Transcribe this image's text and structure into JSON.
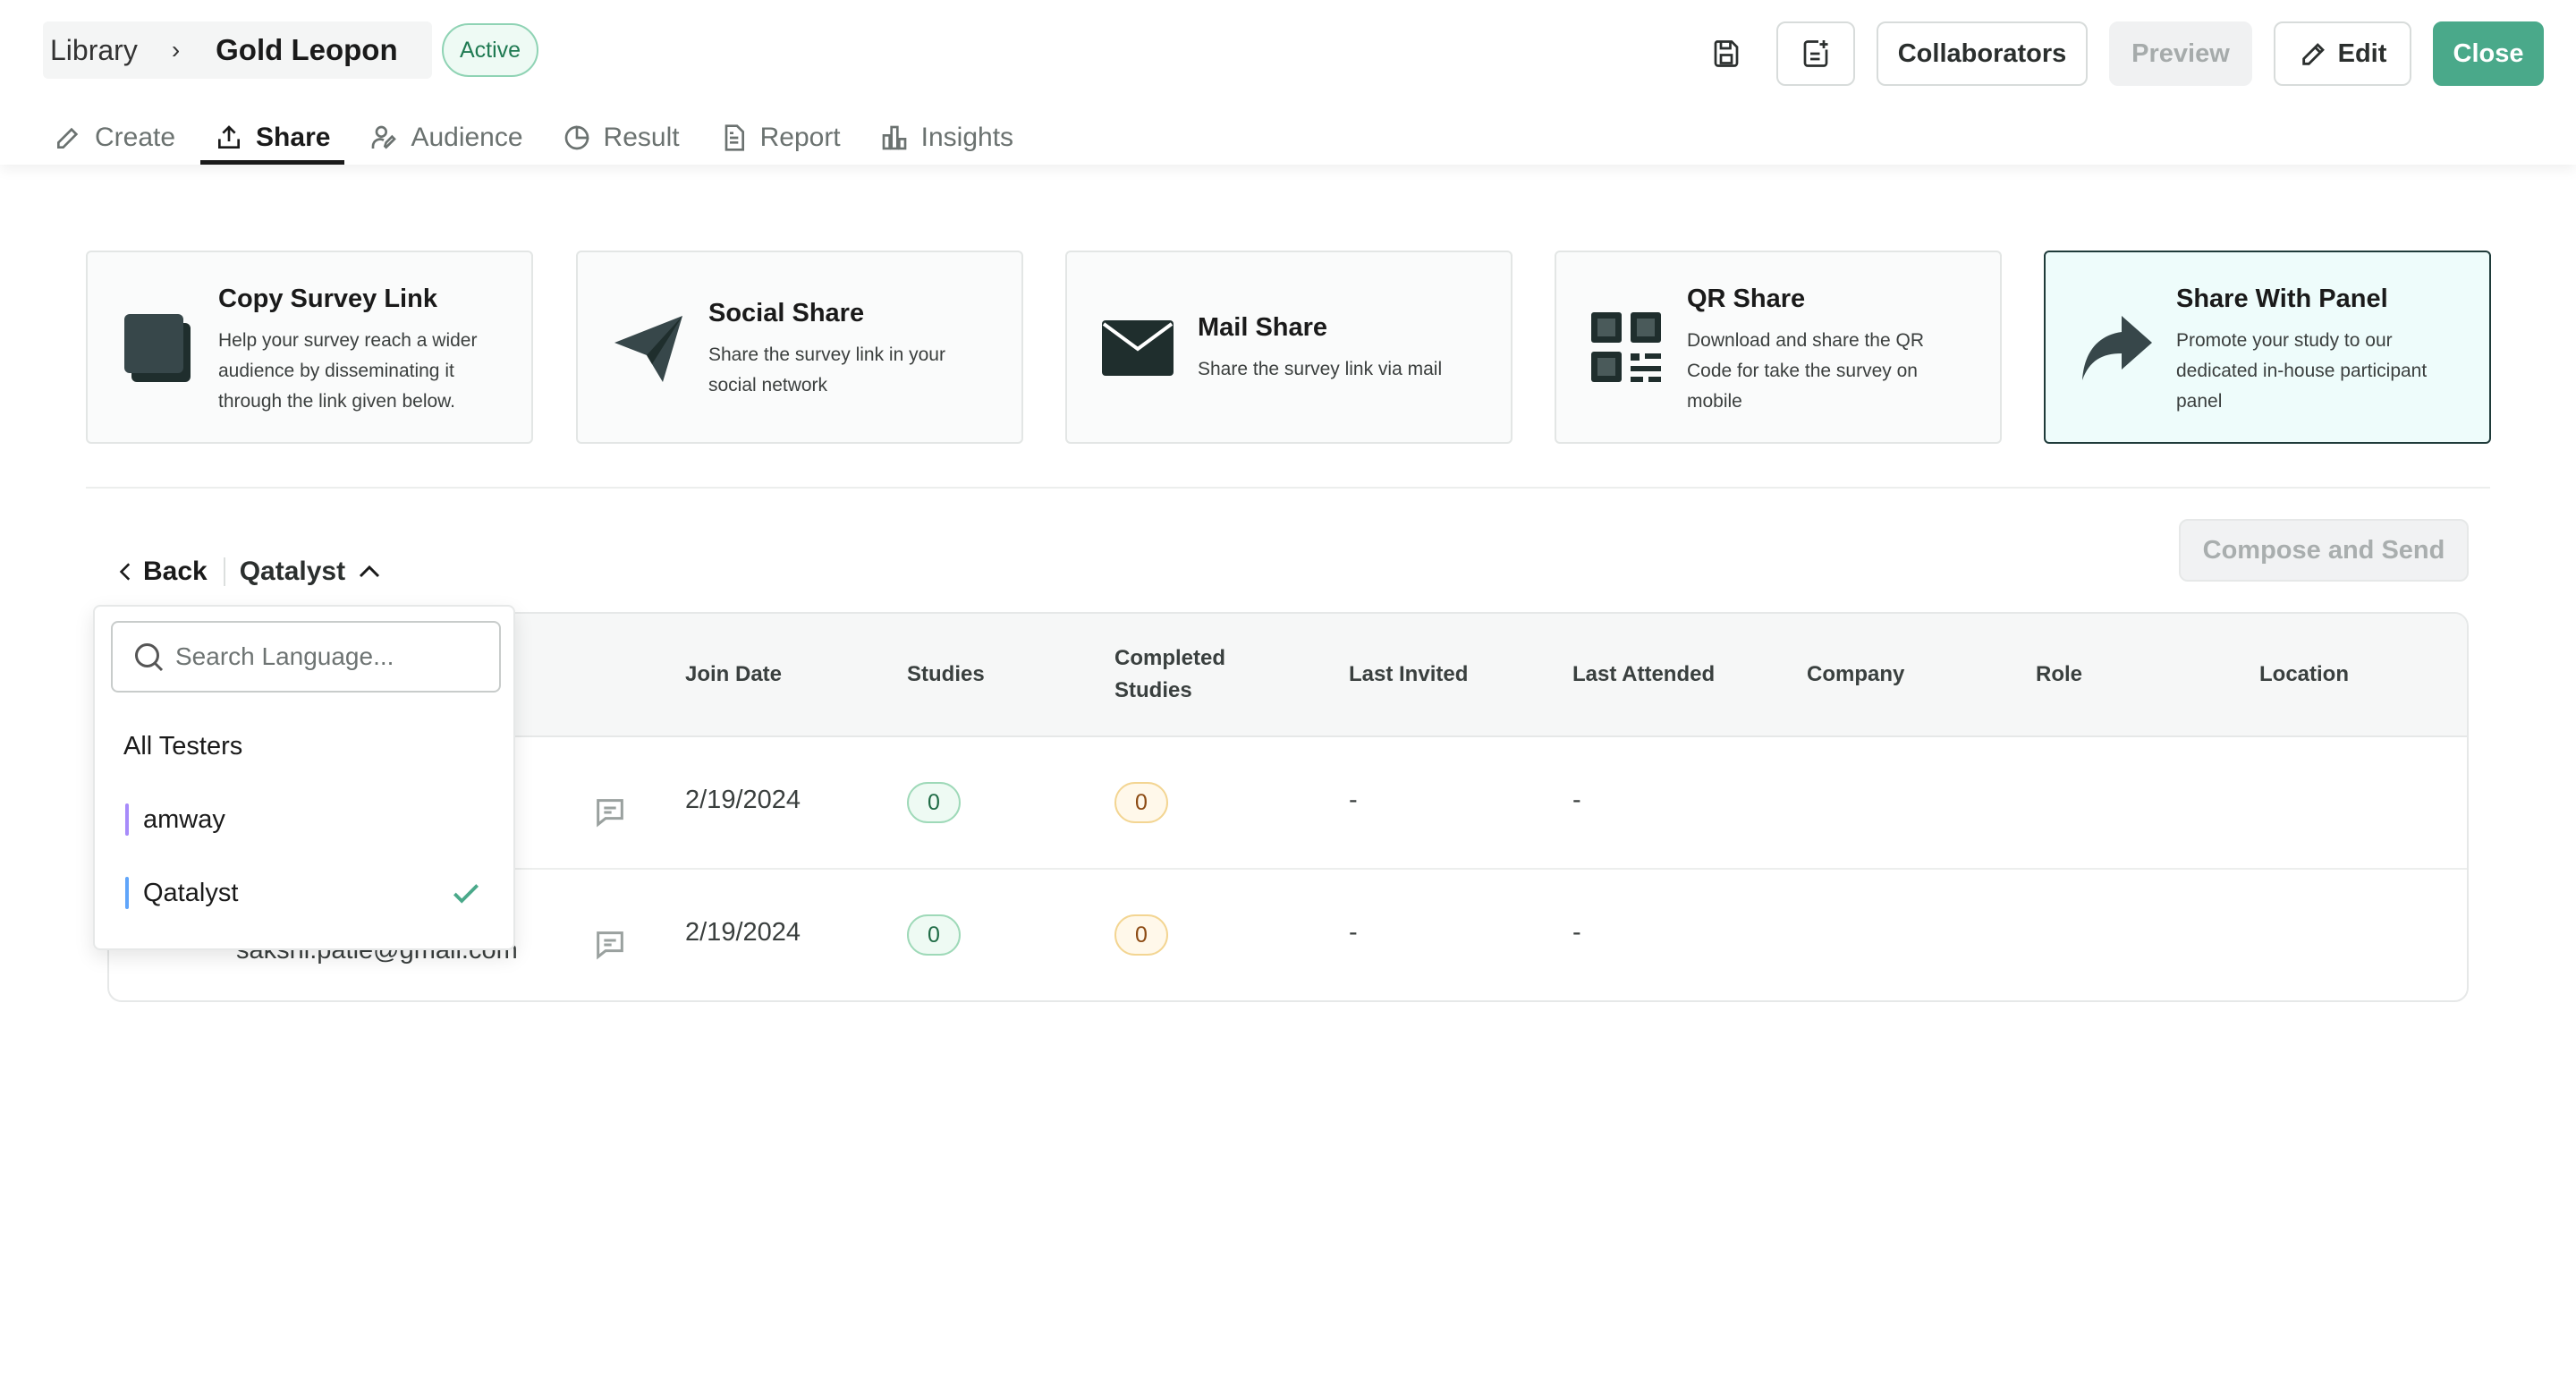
{
  "header": {
    "breadcrumb": {
      "library": "Library",
      "separator": "›",
      "current": "Gold Leopon"
    },
    "status_badge": "Active",
    "buttons": {
      "collaborators": "Collaborators",
      "preview": "Preview",
      "edit": "Edit",
      "close": "Close"
    },
    "icons": {
      "save": "save-icon",
      "add_note": "note-add-icon"
    }
  },
  "tabs": [
    {
      "label": "Create",
      "icon": "pencil-icon",
      "active": false
    },
    {
      "label": "Share",
      "icon": "share-upload-icon",
      "active": true
    },
    {
      "label": "Audience",
      "icon": "audience-icon",
      "active": false
    },
    {
      "label": "Result",
      "icon": "pie-chart-icon",
      "active": false
    },
    {
      "label": "Report",
      "icon": "report-icon",
      "active": false
    },
    {
      "label": "Insights",
      "icon": "bar-chart-icon",
      "active": false
    }
  ],
  "share_options": [
    {
      "title": "Copy Survey Link",
      "description": "Help your survey reach a wider audience by disseminating it through the link given below.",
      "icon": "copy-icon"
    },
    {
      "title": "Social Share",
      "description": "Share the survey link in your social network",
      "icon": "paper-plane-icon"
    },
    {
      "title": "Mail Share",
      "description": "Share the survey link via mail",
      "icon": "envelope-icon"
    },
    {
      "title": "QR Share",
      "description": "Download and share the QR Code for take the survey on mobile",
      "icon": "qr-code-icon"
    },
    {
      "title": "Share With Panel",
      "description": "Promote your study to our dedicated in-house participant panel",
      "icon": "forward-arrow-icon",
      "selected": true
    }
  ],
  "panel": {
    "back_label": "Back",
    "group_label": "Qatalyst",
    "compose_label": "Compose and Send"
  },
  "table": {
    "columns": {
      "join_date": "Join Date",
      "studies": "Studies",
      "completed_line1": "Completed",
      "completed_line2": "Studies",
      "last_invited": "Last Invited",
      "last_attended": "Last Attended",
      "company": "Company",
      "role": "Role",
      "location": "Location"
    },
    "rows": [
      {
        "email": "",
        "join_date": "2/19/2024",
        "studies": "0",
        "completed": "0",
        "last_invited": "-",
        "last_attended": "-"
      },
      {
        "email": "sakshi.patle@gmail.com",
        "join_date": "2/19/2024",
        "studies": "0",
        "completed": "0",
        "last_invited": "-",
        "last_attended": "-"
      }
    ]
  },
  "dropdown": {
    "search_placeholder": "Search Language...",
    "items": [
      {
        "label": "All Testers",
        "selected": false
      },
      {
        "label": "amway",
        "selected": false,
        "accent": "#a78bfa"
      },
      {
        "label": "Qatalyst",
        "selected": true,
        "accent": "#60a5fa"
      }
    ]
  },
  "colors": {
    "primary": "#4aa98a",
    "selected_card_bg": "#eefcfb",
    "check": "#4aa98a"
  }
}
